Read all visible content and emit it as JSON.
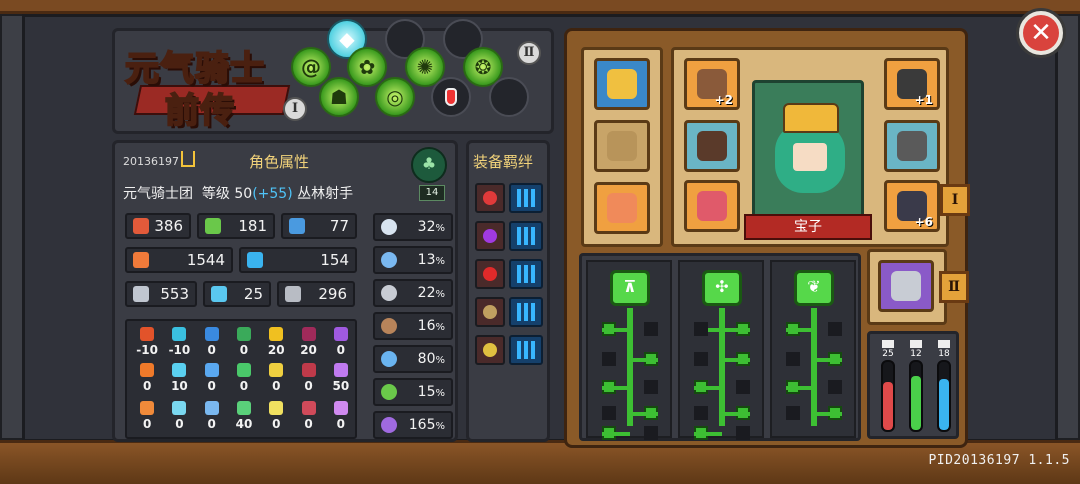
{
  "window": {
    "close_icon": "close-x-icon",
    "version": "PID20136197 1.1.5"
  },
  "logo": {
    "line1": "元气骑士",
    "line2": "前传"
  },
  "talents": {
    "roman_left": "Ⅰ",
    "roman_right": "Ⅱ"
  },
  "profile": {
    "uid": "20136197",
    "panel_title": "角色属性",
    "guild": "元气骑士团",
    "level_label": "等级",
    "level": "50",
    "level_bonus": "(+55)",
    "class_name": "丛林射手",
    "class_level": "14"
  },
  "stats": [
    {
      "icon": "attack-fist-icon",
      "color": "#e25a3a",
      "value": "386"
    },
    {
      "icon": "feather-icon",
      "color": "#6ac84a",
      "value": "181"
    },
    {
      "icon": "book-icon",
      "color": "#4a9ae0",
      "value": "77"
    },
    {
      "icon": "heart-icon",
      "color": "#f07a3a",
      "value": "1544"
    },
    {
      "icon": "mana-drop-icon",
      "color": "#3ab4f0",
      "value": "154"
    },
    {
      "icon": "sword-icon",
      "color": "#c0c6d0",
      "value": "553"
    },
    {
      "icon": "magic-wand-icon",
      "color": "#5ac8f0",
      "value": "25"
    },
    {
      "icon": "shield-icon",
      "color": "#b8bcc4",
      "value": "296"
    }
  ],
  "percent_stats": [
    {
      "icon": "crit-arrow-icon",
      "color": "#d8e4f0",
      "value": "32",
      "unit": "%"
    },
    {
      "icon": "up-arrow-icon",
      "color": "#7ab8f0",
      "value": "13",
      "unit": "%"
    },
    {
      "icon": "crossed-swords-icon",
      "color": "#c8ccd4",
      "value": "22",
      "unit": "%"
    },
    {
      "icon": "boot-icon",
      "color": "#b8845a",
      "value": "16",
      "unit": "%"
    },
    {
      "icon": "clock-icon",
      "color": "#6ab4f0",
      "value": "80",
      "unit": "%"
    },
    {
      "icon": "target-icon",
      "color": "#6ac84a",
      "value": "15",
      "unit": "%"
    },
    {
      "icon": "spiral-icon",
      "color": "#a06ae0",
      "value": "165",
      "unit": "%"
    }
  ],
  "elements": {
    "row1": [
      {
        "icon": "fire-icon",
        "color": "#e2532a",
        "value": "-10"
      },
      {
        "icon": "ice-icon",
        "color": "#3ac0e0",
        "value": "-10"
      },
      {
        "icon": "lightning-icon",
        "color": "#3a8ae0",
        "value": "0"
      },
      {
        "icon": "poison-skull-icon",
        "color": "#3aaa5a",
        "value": "0"
      },
      {
        "icon": "light-icon",
        "color": "#f0c020",
        "value": "20"
      },
      {
        "icon": "dark-icon",
        "color": "#a02a5a",
        "value": "20"
      },
      {
        "icon": "arcane-icon",
        "color": "#a05ae0",
        "value": "0"
      }
    ],
    "row2": [
      {
        "icon": "fire-dmg-icon",
        "color": "#f07a2a",
        "value": "0"
      },
      {
        "icon": "ice-dmg-icon",
        "color": "#5ad0f0",
        "value": "10"
      },
      {
        "icon": "lightning-dmg-icon",
        "color": "#5aa8f0",
        "value": "0"
      },
      {
        "icon": "poison-dmg-icon",
        "color": "#4ac86a",
        "value": "0"
      },
      {
        "icon": "sun-icon",
        "color": "#f0d040",
        "value": "0"
      },
      {
        "icon": "dark-crescent-icon",
        "color": "#c03a4a",
        "value": "0"
      },
      {
        "icon": "arcane-crystal-icon",
        "color": "#c07af0",
        "value": "50"
      }
    ],
    "row3": [
      {
        "icon": "fire-pen-icon",
        "color": "#f08a3a",
        "value": "0"
      },
      {
        "icon": "ice-pen-icon",
        "color": "#7ad8f0",
        "value": "0"
      },
      {
        "icon": "lightning-pen-icon",
        "color": "#7ab8f0",
        "value": "0"
      },
      {
        "icon": "poison-pen-icon",
        "color": "#5ad07a",
        "value": "40"
      },
      {
        "icon": "light-pen-icon",
        "color": "#f0e060",
        "value": "0"
      },
      {
        "icon": "dark-pen-icon",
        "color": "#d04a5a",
        "value": "0"
      },
      {
        "icon": "arcane-pen-icon",
        "color": "#d08af0",
        "value": "0"
      }
    ]
  },
  "bonds": {
    "title": "装备羁绊",
    "items": [
      {
        "icon": "blood-drop-icon",
        "color": "#e03a3a"
      },
      {
        "icon": "void-star-icon",
        "color": "#a03ae0"
      },
      {
        "icon": "demon-face-icon",
        "color": "#e02a2a"
      },
      {
        "icon": "armor-icon",
        "color": "#c0a060"
      },
      {
        "icon": "scroll-icon",
        "color": "#e0c040"
      }
    ]
  },
  "equipment": {
    "left_slots": [
      {
        "icon": "crown-gem-icon",
        "style": "blue",
        "color": "#f0c040"
      },
      {
        "icon": "empty-slot-icon",
        "style": "empty",
        "color": "#b8945a"
      },
      {
        "icon": "dragon-head-icon",
        "style": "orange",
        "color": "#f08a5a"
      }
    ],
    "char_slots": [
      {
        "icon": "skull-totem-icon",
        "style": "orange",
        "color": "#8a5a3a",
        "count": "+2"
      },
      {
        "icon": "leaf-pouch-icon",
        "style": "teal",
        "color": "#5a3a2a",
        "count": ""
      },
      {
        "icon": "meat-icon",
        "style": "orange",
        "color": "#e05a6a",
        "count": ""
      },
      {
        "icon": "panda-mask-icon",
        "style": "orange",
        "color": "#3a3a3a",
        "count": "+1"
      },
      {
        "icon": "iron-chest-icon",
        "style": "teal",
        "color": "#5a5a5a",
        "count": ""
      },
      {
        "icon": "beast-pet-icon",
        "style": "orange",
        "color": "#3a3a4a",
        "count": "+6"
      }
    ],
    "character_name": "宝子",
    "tag_i": "Ⅰ",
    "tag_ii": "Ⅱ",
    "weapon_icon": "axe-weapon-icon"
  },
  "skill_trees": [
    {
      "icon": "crossbow-skill-icon",
      "nodes": [
        "1",
        "1",
        "2",
        "1",
        "1"
      ]
    },
    {
      "icon": "arrows-skill-icon",
      "nodes": [
        "1",
        "1",
        "1",
        "2",
        "1",
        "1"
      ]
    },
    {
      "icon": "leaf-skill-icon",
      "nodes": [
        "1",
        "1",
        "1",
        "1"
      ]
    }
  ],
  "meters": [
    {
      "icon": "bars-icon",
      "label": "25",
      "color": "#e04a4a",
      "level": 0.7
    },
    {
      "icon": "feather-small-icon",
      "label": "12",
      "color": "#4ad04a",
      "level": 0.8
    },
    {
      "icon": "scroll-small-icon",
      "label": "18",
      "color": "#3ab4f0",
      "level": 0.75
    }
  ]
}
